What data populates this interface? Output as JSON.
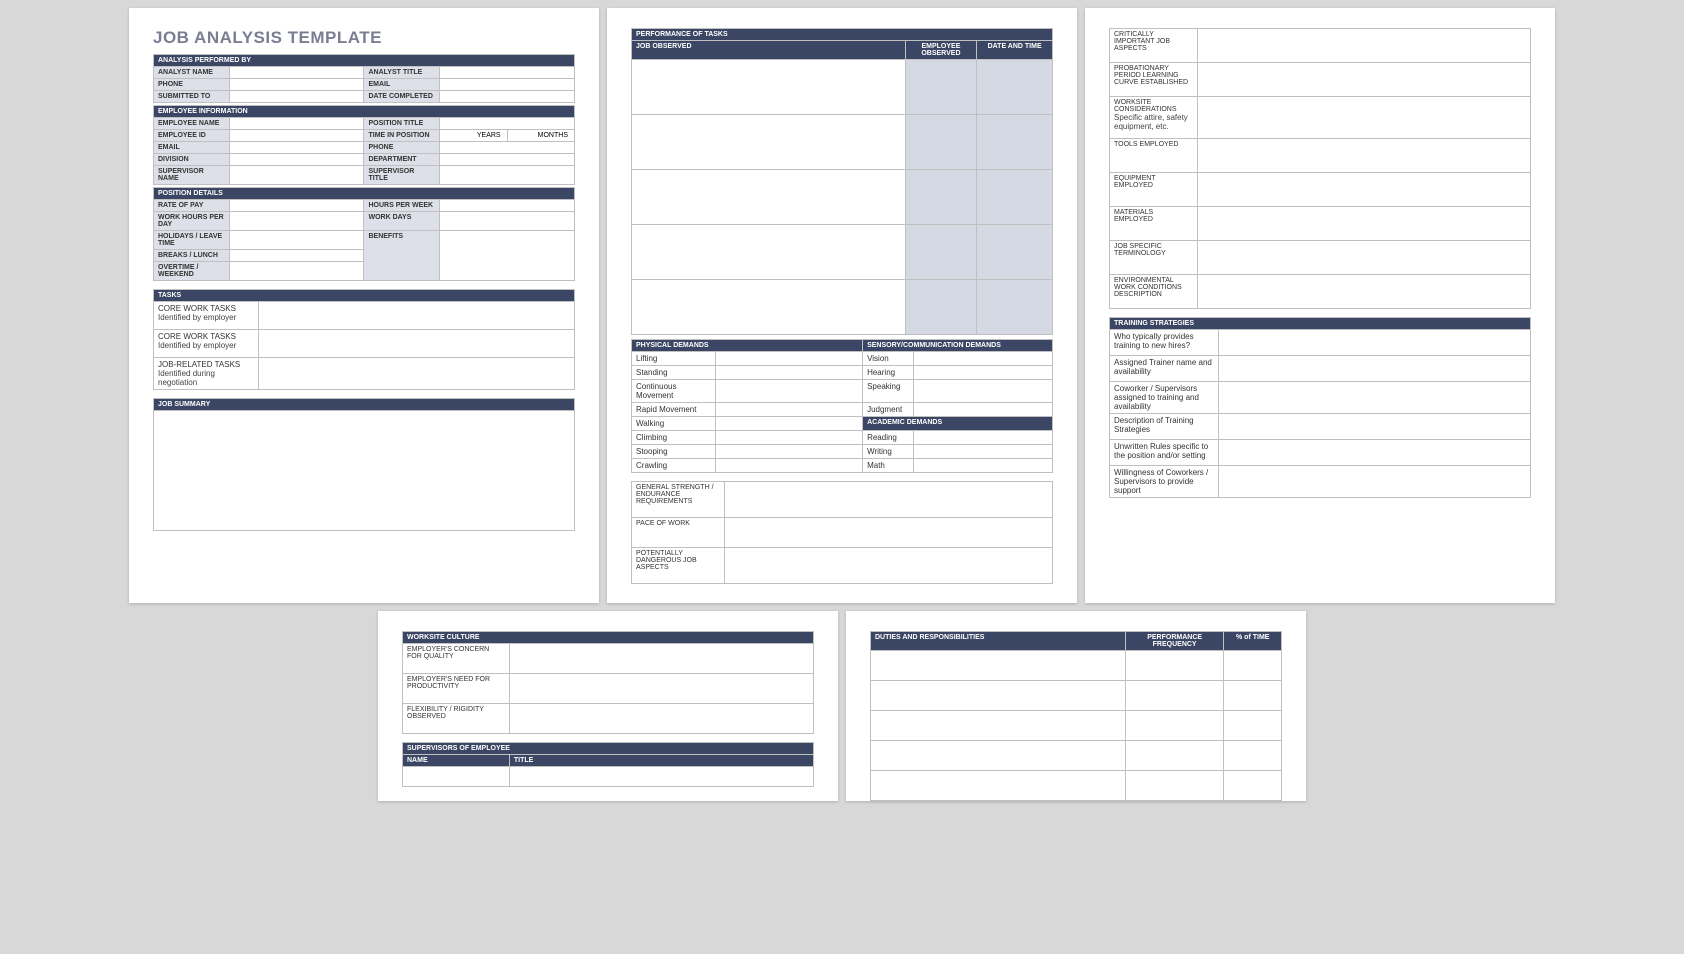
{
  "title": "JOB ANALYSIS TEMPLATE",
  "sec": {
    "analysisPerformedBy": "ANALYSIS PERFORMED BY",
    "analystName": "ANALYST NAME",
    "analystTitle": "ANALYST TITLE",
    "phone": "PHONE",
    "email": "EMAIL",
    "submittedTo": "SUBMITTED TO",
    "dateCompleted": "DATE COMPLETED",
    "employeeInformation": "EMPLOYEE INFORMATION",
    "employeeName": "EMPLOYEE NAME",
    "positionTitle": "POSITION TITLE",
    "employeeId": "EMPLOYEE ID",
    "timeInPosition": "TIME IN POSITION",
    "years": "YEARS",
    "months": "MONTHS",
    "division": "DIVISION",
    "department": "DEPARTMENT",
    "supervisorName": "SUPERVISOR NAME",
    "supervisorTitle": "SUPERVISOR TITLE",
    "positionDetails": "POSITION DETAILS",
    "rateOfPay": "RATE OF PAY",
    "hoursPerWeek": "HOURS PER WEEK",
    "workHoursPerDay": "WORK HOURS PER DAY",
    "workDays": "WORK DAYS",
    "holidaysLeave": "HOLIDAYS / LEAVE TIME",
    "benefits": "BENEFITS",
    "breaksLunch": "BREAKS / LUNCH",
    "overtimeWeekend": "OVERTIME / WEEKEND",
    "tasks": "TASKS",
    "coreWorkTasks": "CORE WORK TASKS",
    "identifiedByEmployer": "Identified by employer",
    "jobRelatedTasks": "JOB-RELATED TASKS",
    "identifiedDuringNegotiation": "Identified during negotiation",
    "jobSummary": "JOB SUMMARY",
    "performanceOfTasks": "PERFORMANCE OF TASKS",
    "jobObserved": "JOB OBSERVED",
    "employeeObserved": "EMPLOYEE OBSERVED",
    "dateAndTime": "DATE AND TIME",
    "physicalDemands": "PHYSICAL DEMANDS",
    "sensoryComm": "SENSORY/COMMUNICATION DEMANDS",
    "lifting": "Lifting",
    "vision": "Vision",
    "standing": "Standing",
    "hearing": "Hearing",
    "contMovement": "Continuous Movement",
    "speaking": "Speaking",
    "rapidMovement": "Rapid Movement",
    "judgment": "Judgment",
    "walking": "Walking",
    "academicDemands": "ACADEMIC DEMANDS",
    "climbing": "Climbing",
    "reading": "Reading",
    "stooping": "Stooping",
    "writing": "Writing",
    "crawling": "Crawling",
    "math": "Math",
    "generalStrength": "GENERAL STRENGTH / ENDURANCE REQUIREMENTS",
    "paceOfWork": "PACE OF WORK",
    "potentiallyDangerous": "POTENTIALLY DANGEROUS JOB ASPECTS",
    "criticallyImportant": "CRITICALLY IMPORTANT JOB ASPECTS",
    "probationary": "PROBATIONARY PERIOD LEARNING CURVE ESTABLISHED",
    "worksiteConsiderations": "WORKSITE CONSIDERATIONS",
    "worksiteConsiderationsSub": "Specific attire, safety equipment, etc.",
    "toolsEmployed": "TOOLS EMPLOYED",
    "equipmentEmployed": "EQUIPMENT EMPLOYED",
    "materialsEmployed": "MATERIALS EMPLOYED",
    "jobSpecificTerm": "JOB SPECIFIC TERMINOLOGY",
    "envWorkConditions": "ENVIRONMENTAL WORK CONDITIONS DESCRIPTION",
    "trainingStrategies": "TRAINING STRATEGIES",
    "whoProvides": "Who typically provides training to new hires?",
    "assignedTrainer": "Assigned Trainer name and availability",
    "coworkerSupervisors": "Coworker / Supervisors assigned to training and availability",
    "descTrainingStrategies": "Description of Training Strategies",
    "unwrittenRules": "Unwritten Rules specific to the position and/or setting",
    "willingnessCoworkers": "Willingness of Coworkers / Supervisors to provide support",
    "worksiteCulture": "WORKSITE CULTURE",
    "employerConcern": "EMPLOYER'S CONCERN FOR QUALITY",
    "employerNeed": "EMPLOYER'S NEED FOR PRODUCTIVITY",
    "flexibilityRigidity": "FLEXIBILITY / RIGIDITY OBSERVED",
    "supervisorsOfEmployee": "SUPERVISORS OF EMPLOYEE",
    "name": "NAME",
    "titleCol": "TITLE",
    "dutiesResponsibilities": "DUTIES AND RESPONSIBILITIES",
    "performanceFrequency": "PERFORMANCE FREQUENCY",
    "pctOfTime": "% of TIME"
  }
}
